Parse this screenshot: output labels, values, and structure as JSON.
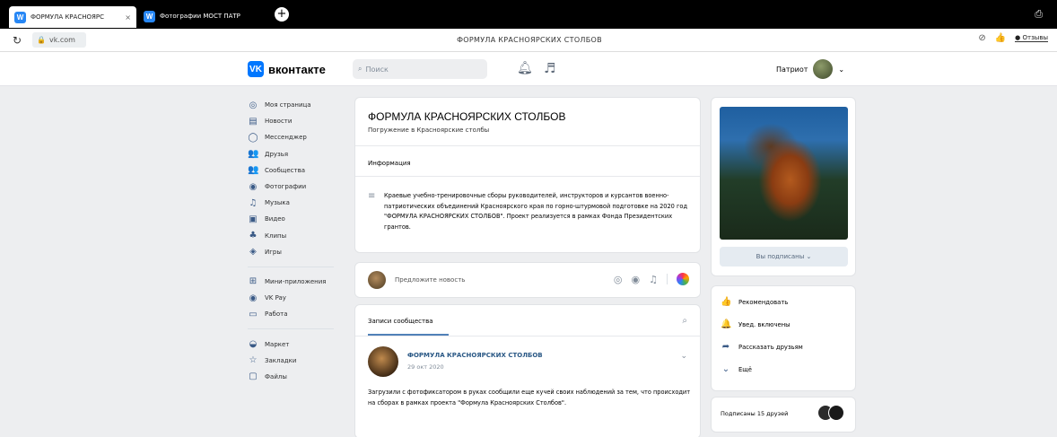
{
  "browser": {
    "tabs": [
      {
        "label": "ФОРМУЛА КРАСНОЯРС",
        "close": "×"
      },
      {
        "label": "Фотографии МОСТ ПАТР"
      }
    ],
    "new_tab": "+",
    "url": "vk.com",
    "page_title": "ФОРМУЛА КРАСНОЯРСКИХ СТОЛБОВ",
    "reviews_label": "Отзывы"
  },
  "header": {
    "logo_mark": "VK",
    "logo_text": "вконтакте",
    "search_placeholder": "Поиск",
    "user_name": "Патриот",
    "user_chevron": "⌄"
  },
  "nav": {
    "main": [
      {
        "label": "Моя страница",
        "icon": "◎"
      },
      {
        "label": "Новости",
        "icon": "▤"
      },
      {
        "label": "Мессенджер",
        "icon": "◯"
      },
      {
        "label": "Друзья",
        "icon": "👥"
      },
      {
        "label": "Сообщества",
        "icon": "👥"
      },
      {
        "label": "Фотографии",
        "icon": "◉"
      },
      {
        "label": "Музыка",
        "icon": "♫"
      },
      {
        "label": "Видео",
        "icon": "▣"
      },
      {
        "label": "Клипы",
        "icon": "♣"
      },
      {
        "label": "Игры",
        "icon": "◈"
      }
    ],
    "services": [
      {
        "label": "Мини-приложения",
        "icon": "⊞"
      },
      {
        "label": "VK Pay",
        "icon": "◉"
      },
      {
        "label": "Работа",
        "icon": "▭"
      }
    ],
    "extra": [
      {
        "label": "Маркет",
        "icon": "◒"
      },
      {
        "label": "Закладки",
        "icon": "☆"
      },
      {
        "label": "Файлы",
        "icon": "▢"
      }
    ]
  },
  "group": {
    "title": "ФОРМУЛА КРАСНОЯРСКИХ СТОЛБОВ",
    "status": "Погружение в Красноярские столбы",
    "info_label": "Информация",
    "info_text": "Краевые учебно-тренировочные сборы руководителей, инструкторов и курсантов военно-патриотических объединений Красноярского края по горно-штурмовой подготовке на 2020 год \"ФОРМУЛА КРАСНОЯРСКИХ СТОЛБОВ\". Проект реализуется в рамках Фонда Президентских грантов."
  },
  "suggest": {
    "placeholder": "Предложите новость"
  },
  "posts": {
    "tab_label": "Записи сообщества",
    "author": "ФОРМУЛА КРАСНОЯРСКИХ СТОЛБОВ",
    "date": "29 окт 2020",
    "text": "Загрузили с фотофиксатором в руках сообщили еще кучей своих наблюдений за тем, что происходит на сборах в рамках проекта \"Формула Красноярских Столбов\"."
  },
  "sidebar": {
    "subscribed_label": "Вы подписаны ⌄",
    "actions": [
      {
        "label": "Рекомендовать",
        "icon": "👍"
      },
      {
        "label": "Увед. включены",
        "icon": "🔔"
      },
      {
        "label": "Рассказать друзьям",
        "icon": "➦"
      },
      {
        "label": "Ещё",
        "icon": "⌄"
      }
    ],
    "friends_label": "Подписаны 15 друзей"
  },
  "colors": {
    "vk_blue": "#0077ff",
    "link": "#2a5885",
    "background": "#edeef0"
  }
}
